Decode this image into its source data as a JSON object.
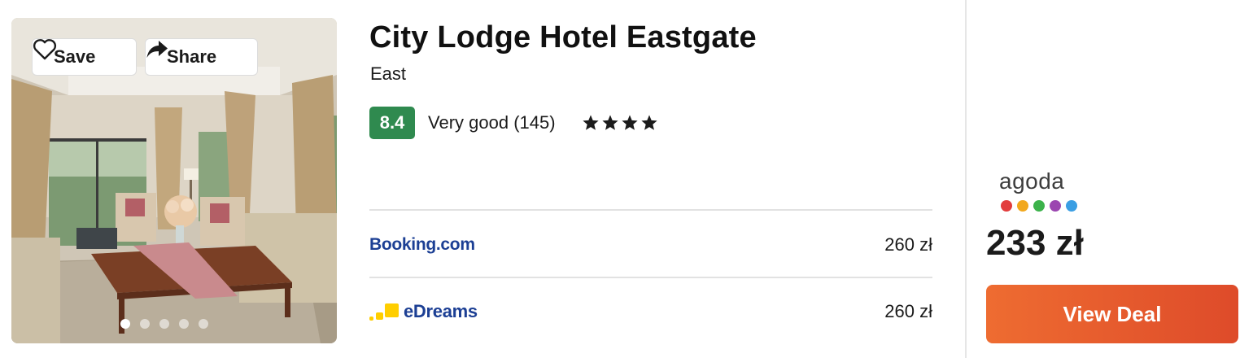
{
  "hotel": {
    "name": "City Lodge Hotel Eastgate",
    "location": "East",
    "score": "8.4",
    "rating_text": "Very good (145)",
    "stars": 4,
    "star_glyph": "★"
  },
  "photo": {
    "save_label": "Save",
    "share_label": "Share",
    "carousel_dot_count": 5,
    "active_dot": 1
  },
  "offers": [
    {
      "provider": "Booking.com",
      "price": "260 zł"
    },
    {
      "provider": "eDreams",
      "price": "260 zł"
    }
  ],
  "best_deal": {
    "provider": "agoda",
    "price": "233 zł",
    "button_label": "View Deal",
    "logo_dot_colors": [
      "#e23c3c",
      "#f2a81d",
      "#3cb24b",
      "#9b46b0",
      "#3a9ee3"
    ]
  },
  "colors": {
    "score_badge": "#2f8a4f",
    "cta_gradient_start": "#ee6c31",
    "cta_gradient_end": "#de4b2a",
    "partner_logo_blue": "#1c3f94",
    "edreams_yellow": "#ffce00"
  }
}
